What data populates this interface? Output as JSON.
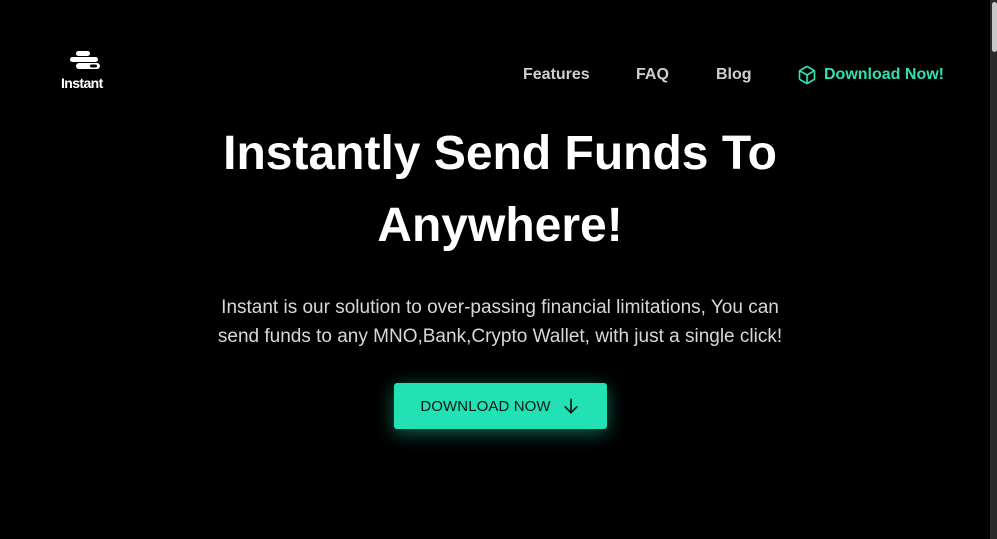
{
  "header": {
    "logo_text": "Instant",
    "logo_icon": "wallet-stack-icon",
    "nav": [
      {
        "label": "Features"
      },
      {
        "label": "FAQ"
      },
      {
        "label": "Blog"
      }
    ],
    "download_link": {
      "label": "Download Now!",
      "icon": "cube-icon"
    }
  },
  "hero": {
    "title": "Instantly Send Funds To Anywhere!",
    "description": "Instant is our solution to over-passing financial limitations, You can send funds to any MNO,Bank,Crypto Wallet, with just a single click!",
    "cta": {
      "label": "DOWNLOAD NOW",
      "icon": "arrow-down-icon"
    }
  },
  "colors": {
    "background": "#000000",
    "accent": "#22e1b4",
    "nav_text": "#cfcfcf",
    "title_text": "#ffffff"
  }
}
